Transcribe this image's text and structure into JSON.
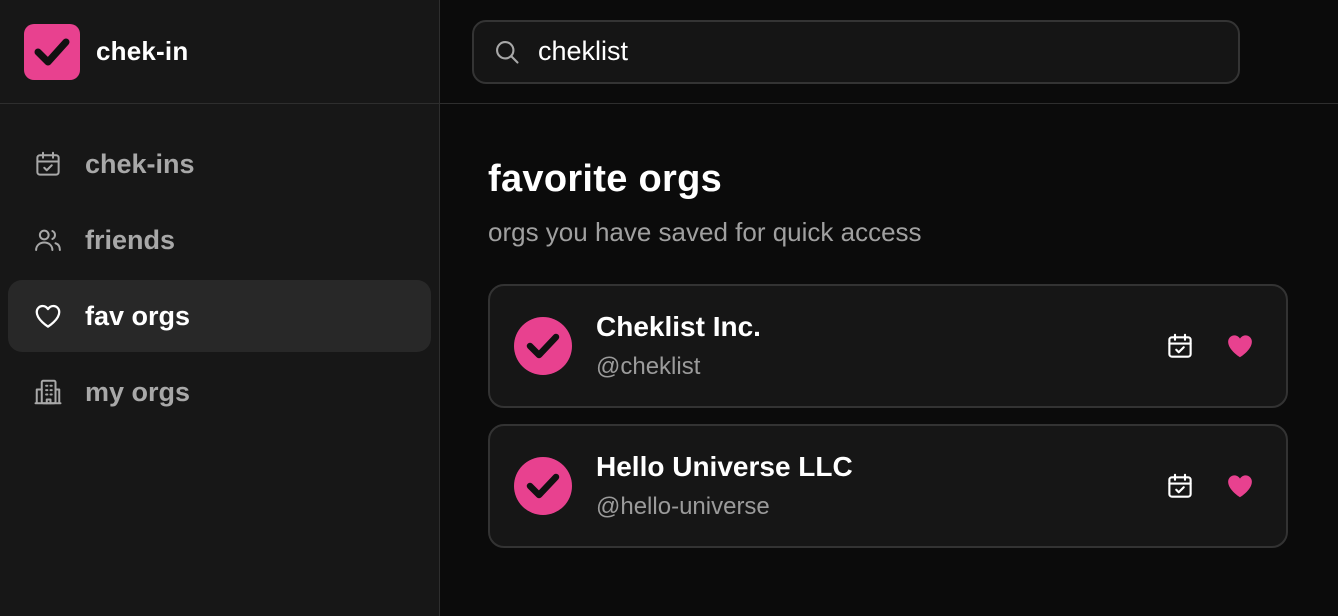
{
  "app": {
    "name": "chek-in",
    "accent_color": "#e8418f",
    "logo_icon": "checkmark-icon"
  },
  "sidebar": {
    "items": [
      {
        "label": "chek-ins",
        "icon": "calendar-check-icon",
        "active": false
      },
      {
        "label": "friends",
        "icon": "users-icon",
        "active": false
      },
      {
        "label": "fav orgs",
        "icon": "heart-icon",
        "active": true
      },
      {
        "label": "my orgs",
        "icon": "building-icon",
        "active": false
      }
    ]
  },
  "search": {
    "value": "cheklist",
    "icon": "search-icon"
  },
  "main": {
    "title": "favorite orgs",
    "subtitle": "orgs you have saved for quick access",
    "orgs": [
      {
        "name": "Cheklist Inc.",
        "handle": "@cheklist",
        "favorited": true
      },
      {
        "name": "Hello Universe LLC",
        "handle": "@hello-universe",
        "favorited": true
      }
    ]
  }
}
